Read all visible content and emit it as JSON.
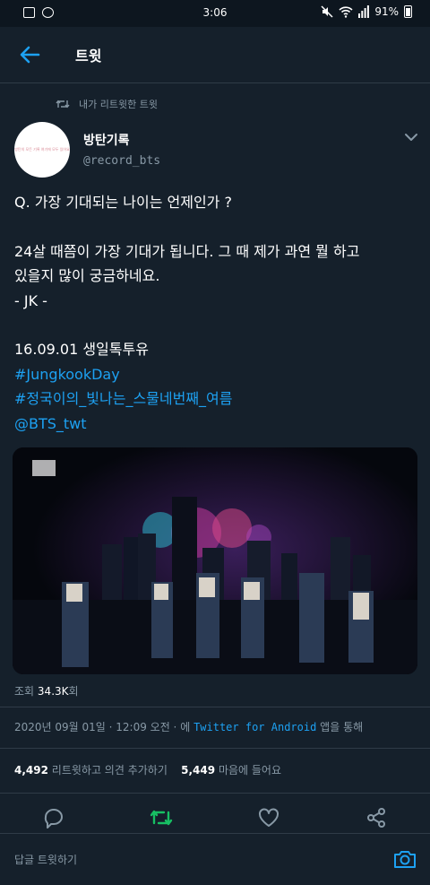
{
  "status_bar": {
    "time": "3:06",
    "battery": "91%"
  },
  "header": {
    "title": "트윗"
  },
  "retweet_context": {
    "label": "내가 리트윗한 트윗"
  },
  "author": {
    "name": "방탄기록",
    "handle": "@record_bts",
    "avatar_text": "방탄의 모든 기록 여기에 모두 있어요"
  },
  "tweet": {
    "lines": [
      "Q. 가장 기대되는 나이는 언제인가 ?",
      "",
      "24살 때쯤이 가장 기대가 됩니다. 그 때 제가 과연 뭘 하고",
      "있을지 많이 궁금하네요.",
      " - JK -",
      "",
      "16.09.01 생일톡투유"
    ],
    "hashtags": [
      "#JungkookDay",
      "#정국이의_빛나는_스물네번째_여름",
      "@BTS_twt"
    ]
  },
  "media": {
    "type": "video",
    "description_icon": "mtv-logo-icon"
  },
  "views": {
    "count": "34.3K",
    "prefix": "조회",
    "suffix": "회"
  },
  "meta": {
    "date": "2020년 09월 01일 · 12:09 오전 · 에",
    "app": "Twitter for Android",
    "suffix": "앱을 통해"
  },
  "stats": {
    "retweets": "4,492",
    "retweets_label": "리트윗하고 의견 추가하기",
    "likes": "5,449",
    "likes_label": "마음에 들어요"
  },
  "reply": {
    "placeholder": "답글 트윗하기"
  },
  "colors": {
    "background": "#15202b",
    "accent": "#1da1f2",
    "retweet_green": "#17bf63",
    "muted": "#8899a6"
  }
}
